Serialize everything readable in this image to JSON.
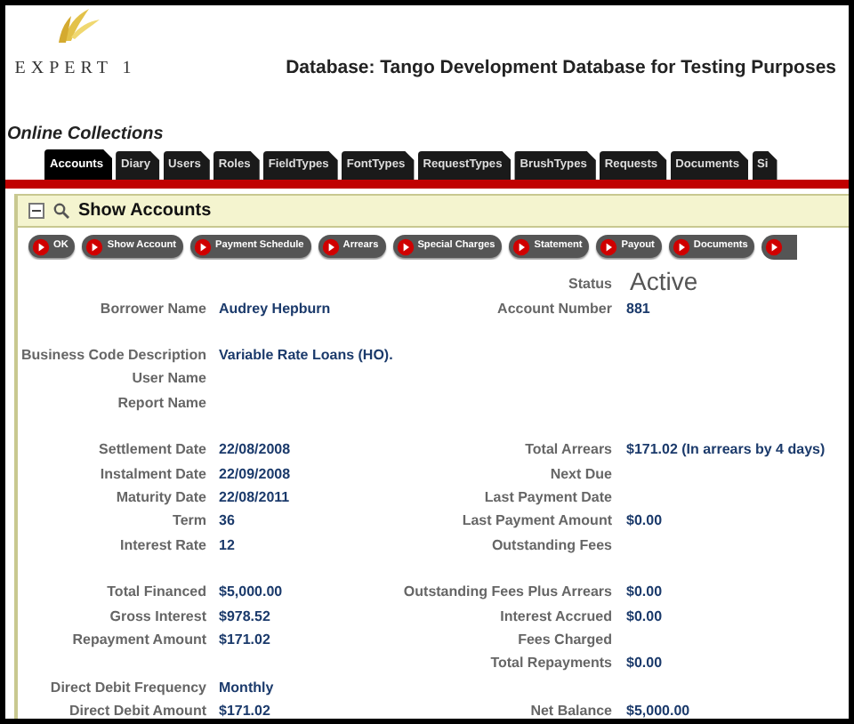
{
  "logo": {
    "text": "EXPERT 1"
  },
  "database_title": "Database: Tango Development Database for Testing Purposes",
  "app_title": "Online Collections",
  "tabs": [
    {
      "label": "Accounts",
      "selected": true
    },
    {
      "label": "Diary",
      "selected": false
    },
    {
      "label": "Users",
      "selected": false
    },
    {
      "label": "Roles",
      "selected": false
    },
    {
      "label": "FieldTypes",
      "selected": false
    },
    {
      "label": "FontTypes",
      "selected": false
    },
    {
      "label": "RequestTypes",
      "selected": false
    },
    {
      "label": "BrushTypes",
      "selected": false
    },
    {
      "label": "Requests",
      "selected": false
    },
    {
      "label": "Documents",
      "selected": false
    },
    {
      "label": "Si",
      "selected": false
    }
  ],
  "panel": {
    "title": "Show Accounts",
    "expanded": true,
    "buttons": [
      "OK",
      "Show Account",
      "Payment Schedule",
      "Arrears",
      "Special Charges",
      "Statement",
      "Payout",
      "Documents"
    ],
    "more_button": true,
    "status": {
      "label": "Status",
      "value": "Active"
    },
    "sections": [
      [
        {
          "left_label": "Borrower Name",
          "left_value": "Audrey Hepburn",
          "right_label": "Account Number",
          "right_value": "881"
        }
      ],
      [
        {
          "left_label": "Business Code Description",
          "left_value": "Variable Rate Loans (HO)."
        },
        {
          "left_label": "User Name"
        },
        {
          "left_label": "Report Name"
        }
      ],
      [
        {
          "left_label": "Settlement Date",
          "left_value": "22/08/2008",
          "right_label": "Total Arrears",
          "right_value": "$171.02 (In arrears by 4 days)"
        },
        {
          "left_label": "Instalment Date",
          "left_value": "22/09/2008",
          "right_label": "Next Due"
        },
        {
          "left_label": "Maturity Date",
          "left_value": "22/08/2011",
          "right_label": "Last Payment Date"
        },
        {
          "left_label": "Term",
          "left_value": "36",
          "right_label": "Last Payment Amount",
          "right_value": "$0.00"
        },
        {
          "left_label": "Interest Rate",
          "left_value": "12",
          "right_label": "Outstanding Fees"
        }
      ],
      [
        {
          "left_label": "Total Financed",
          "left_value": "$5,000.00",
          "right_label": "Outstanding Fees Plus Arrears",
          "right_value": "$0.00"
        },
        {
          "left_label": "Gross Interest",
          "left_value": "$978.52",
          "right_label": "Interest Accrued",
          "right_value": "$0.00"
        },
        {
          "left_label": "Repayment Amount",
          "left_value": "$171.02",
          "right_label": "Fees Charged"
        },
        {
          "right_label": "Total Repayments",
          "right_value": "$0.00"
        },
        {
          "left_label": "Direct Debit Frequency",
          "left_value": "Monthly"
        },
        {
          "left_label": "Direct Debit Amount",
          "left_value": "$171.02",
          "right_label": "Net Balance",
          "right_value": "$5,000.00"
        }
      ]
    ]
  }
}
